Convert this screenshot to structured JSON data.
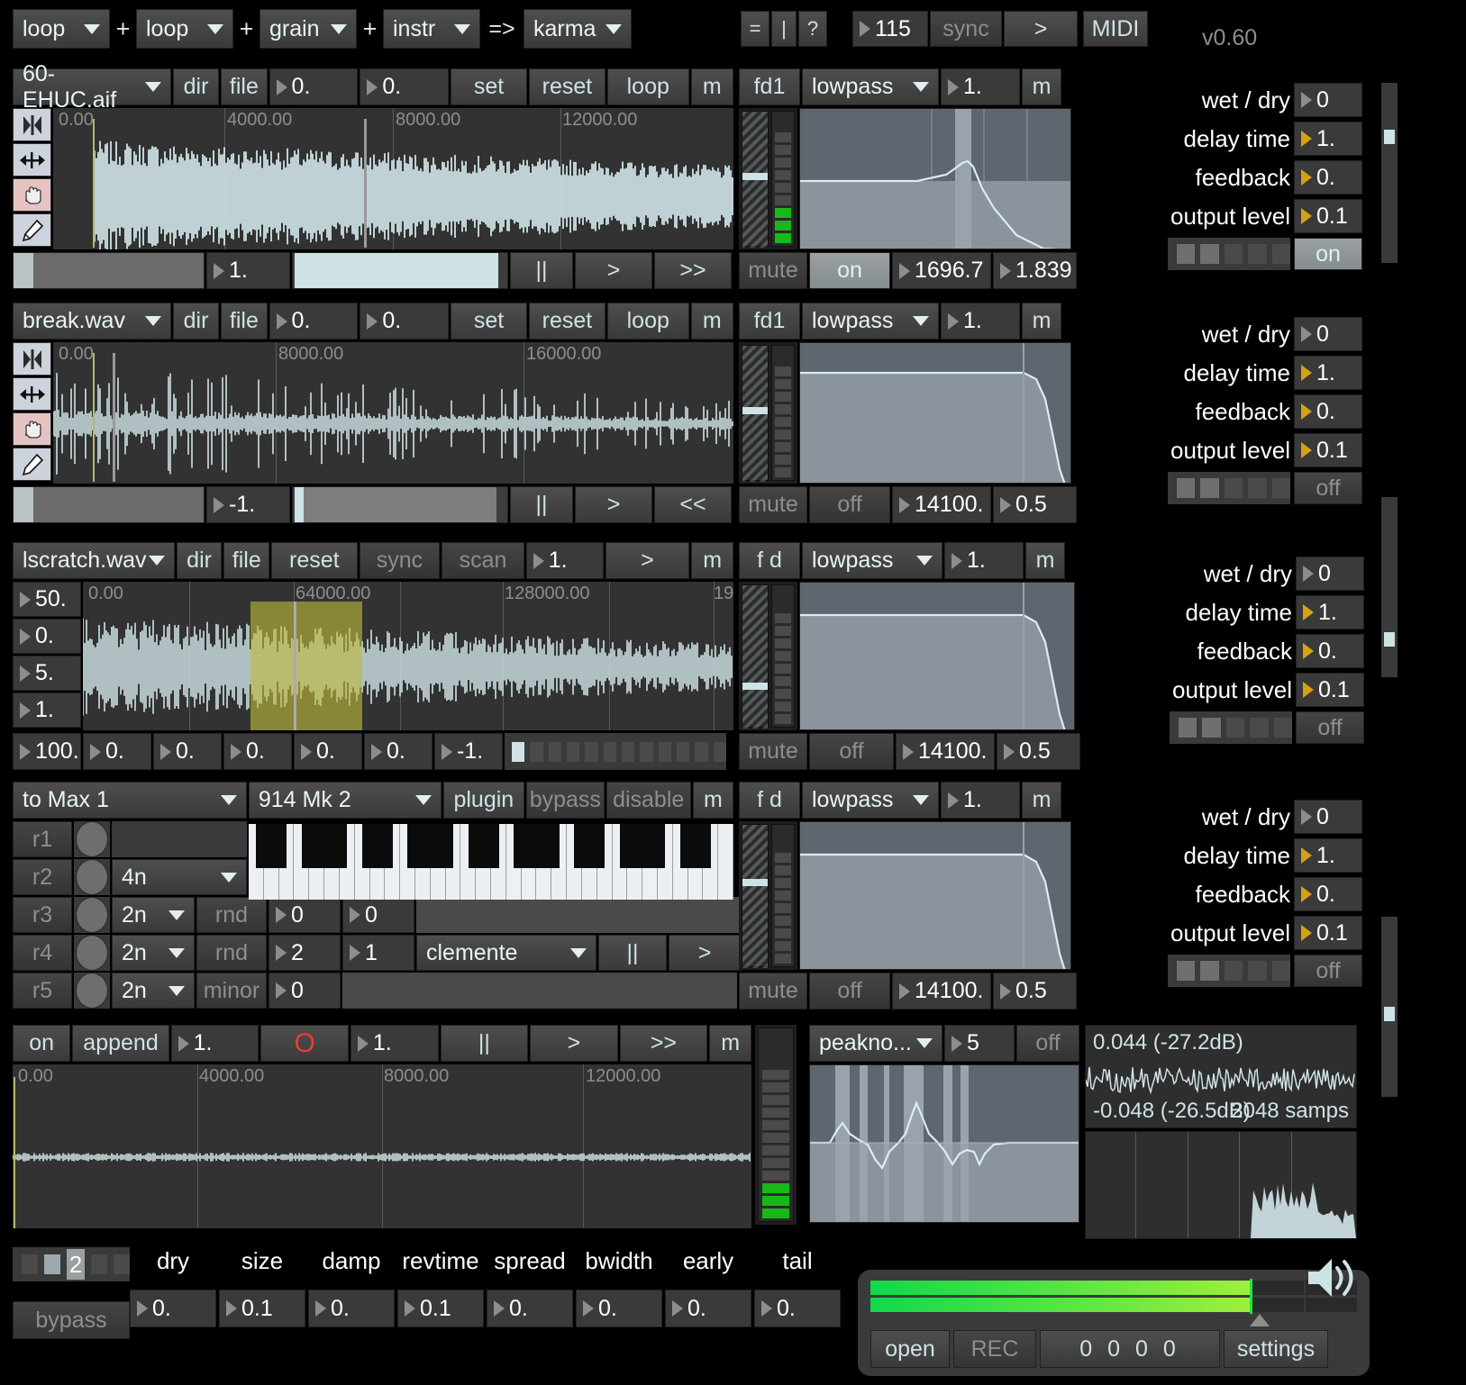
{
  "app": {
    "version": "v0.60"
  },
  "header": {
    "chain": [
      {
        "label": "loop"
      },
      {
        "plus": "+"
      },
      {
        "label": "loop"
      },
      {
        "plus": "+"
      },
      {
        "label": "grain"
      },
      {
        "plus": "+"
      },
      {
        "label": "instr"
      },
      {
        "arrow": "=>"
      },
      {
        "label": "karma"
      }
    ],
    "chain_labels": [
      "loop",
      "loop",
      "grain",
      "instr",
      "karma"
    ],
    "plus1": "+",
    "plus2": "+",
    "plus3": "+",
    "arrow": "=>",
    "eq": "=",
    "bar": "|",
    "help": "?",
    "tempo": "115",
    "sync": "sync",
    "play": ">",
    "midi": "MIDI"
  },
  "tracks": [
    {
      "file": "60-EHUC.aif",
      "dir": "dir",
      "file_btn": "file",
      "n1": "0.",
      "n2": "0.",
      "set": "set",
      "reset": "reset",
      "loop": "loop",
      "m": "m",
      "fd": "fd1",
      "filter_type": "lowpass",
      "filter_amt": "1.",
      "fm": "m",
      "mute": "mute",
      "fstate": "on",
      "freq": "1696.7",
      "q": "1.839",
      "ruler": [
        "0.00",
        "4000.00",
        "8000.00",
        "12000.00"
      ],
      "rate": "1.",
      "pause": "||",
      "play": ">",
      "fwd": ">>",
      "fx": {
        "wet_dry_label": "wet / dry",
        "wet_dry": "0",
        "delay_label": "delay time",
        "delay": "1.",
        "feedback_label": "feedback",
        "feedback": "0.",
        "output_label": "output level",
        "output": "0.1",
        "state": "on"
      }
    },
    {
      "file": "break.wav",
      "dir": "dir",
      "file_btn": "file",
      "n1": "0.",
      "n2": "0.",
      "set": "set",
      "reset": "reset",
      "loop": "loop",
      "m": "m",
      "fd": "fd1",
      "filter_type": "lowpass",
      "filter_amt": "1.",
      "fm": "m",
      "mute": "mute",
      "fstate": "off",
      "freq": "14100.",
      "q": "0.5",
      "ruler": [
        "0.00",
        "8000.00",
        "16000.00"
      ],
      "rate": "-1.",
      "pause": "||",
      "play": ">",
      "fwd": "<<",
      "fx": {
        "wet_dry_label": "wet / dry",
        "wet_dry": "0",
        "delay_label": "delay time",
        "delay": "1.",
        "feedback_label": "feedback",
        "feedback": "0.",
        "output_label": "output level",
        "output": "0.1",
        "state": "off"
      }
    }
  ],
  "grain": {
    "file": "lscratch.wav",
    "dir": "dir",
    "file_btn": "file",
    "reset": "reset",
    "sync": "sync",
    "scan": "scan",
    "rate": "1.",
    "play": ">",
    "m": "m",
    "left_params": [
      "50.",
      "0.",
      "5.",
      "1."
    ],
    "ruler": [
      "0.00",
      "64000.00",
      "128000.00",
      "19"
    ],
    "bottom_params": [
      "100.",
      "0.",
      "0.",
      "0.",
      "0.",
      "0.",
      "-1."
    ],
    "fd": "f d",
    "filter_type": "lowpass",
    "filter_amt": "1.",
    "fm": "m",
    "mute": "mute",
    "fstate": "off",
    "freq": "14100.",
    "q": "0.5",
    "steps_count": 12,
    "step_active": 0,
    "fx": {
      "wet_dry_label": "wet / dry",
      "wet_dry": "0",
      "delay_label": "delay time",
      "delay": "1.",
      "feedback_label": "feedback",
      "feedback": "0.",
      "output_label": "output level",
      "output": "0.1",
      "state": "off"
    }
  },
  "instr": {
    "dest": "to Max 1",
    "plugin_name": "914 Mk 2",
    "plugin": "plugin",
    "bypass": "bypass",
    "disable": "disable",
    "m": "m",
    "rows": [
      {
        "name": "r1",
        "div": "",
        "rnd": "",
        "v1": "",
        "v2": ""
      },
      {
        "name": "r2",
        "div": "4n",
        "rnd": "",
        "v1": "",
        "v2": ""
      },
      {
        "name": "r3",
        "div": "2n",
        "rnd": "rnd",
        "v1": "0",
        "v2": "0"
      },
      {
        "name": "r4",
        "div": "2n",
        "rnd": "rnd",
        "v1": "2",
        "v2": "1"
      },
      {
        "name": "r5",
        "div": "2n",
        "rnd": "minor",
        "v1": "0",
        "v2": ""
      }
    ],
    "scale": "clemente",
    "pause": "||",
    "play": ">",
    "fd": "f d",
    "filter_type": "lowpass",
    "filter_amt": "1.",
    "fm": "m",
    "mute": "mute",
    "fstate": "off",
    "freq": "14100.",
    "q": "0.5",
    "fx": {
      "wet_dry_label": "wet / dry",
      "wet_dry": "0",
      "delay_label": "delay time",
      "delay": "1.",
      "feedback_label": "feedback",
      "feedback": "0.",
      "output_label": "output level",
      "output": "0.1",
      "state": "off"
    }
  },
  "karma": {
    "on": "on",
    "append": "append",
    "n1": "1.",
    "rec": "O",
    "n2": "1.",
    "pause": "||",
    "play": ">",
    "fwd": ">>",
    "m": "m",
    "ruler": [
      "0.00",
      "4000.00",
      "8000.00",
      "12000.00"
    ],
    "analyzer_type": "peakno...",
    "analyzer_n": "5",
    "analyzer_state": "off",
    "scope_top": "0.044 (-27.2dB)",
    "scope_bottom": "-0.048 (-26.5dB)",
    "scope_samps": "2048 samps"
  },
  "reverb": {
    "preset": "2",
    "bypass": "bypass",
    "params": [
      {
        "label": "dry",
        "value": "0."
      },
      {
        "label": "size",
        "value": "0.1"
      },
      {
        "label": "damp",
        "value": "0."
      },
      {
        "label": "revtime",
        "value": "0.1"
      },
      {
        "label": "spread",
        "value": "0."
      },
      {
        "label": "bwidth",
        "value": "0."
      },
      {
        "label": "early",
        "value": "0."
      },
      {
        "label": "tail",
        "value": "0."
      }
    ]
  },
  "master": {
    "open": "open",
    "rec": "REC",
    "counter": "0 0 0 0",
    "settings": "settings",
    "meter_pct": 78
  },
  "icons": {
    "flip": "flip-icon",
    "stretch": "stretch-icon",
    "hand": "hand-icon",
    "pencil": "pencil-icon",
    "speaker": "speaker-icon"
  }
}
